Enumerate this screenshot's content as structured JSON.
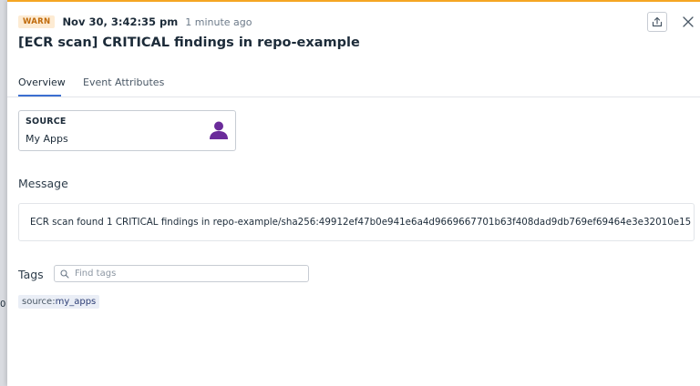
{
  "backdrop": {
    "fragment_text": "0"
  },
  "header": {
    "level_badge": "WARN",
    "timestamp": "Nov 30, 3:42:35 pm",
    "relative_time": "1 minute ago",
    "title": "[ECR scan] CRITICAL findings in repo-example",
    "share_icon": "share-icon",
    "close_icon": "close-icon"
  },
  "tabs": [
    {
      "label": "Overview",
      "active": true
    },
    {
      "label": "Event Attributes",
      "active": false
    }
  ],
  "source": {
    "label": "SOURCE",
    "value": "My Apps",
    "icon": "user-icon",
    "icon_color": "#6a2b9a"
  },
  "message": {
    "heading": "Message",
    "text": "ECR scan found 1 CRITICAL findings in repo-example/sha256:49912ef47b0e941e6a4d9669667701b63f408dad9db769ef69464e3e32010e15"
  },
  "tags": {
    "heading": "Tags",
    "search_placeholder": "Find tags",
    "search_value": "",
    "items": [
      {
        "key": "source:",
        "value": "my_apps"
      }
    ]
  },
  "colors": {
    "warn_accent": "#f5a623",
    "active_tab": "#3b6fd1",
    "warn_badge_text": "#c06a0a",
    "warn_badge_bg": "#fdebd3"
  }
}
